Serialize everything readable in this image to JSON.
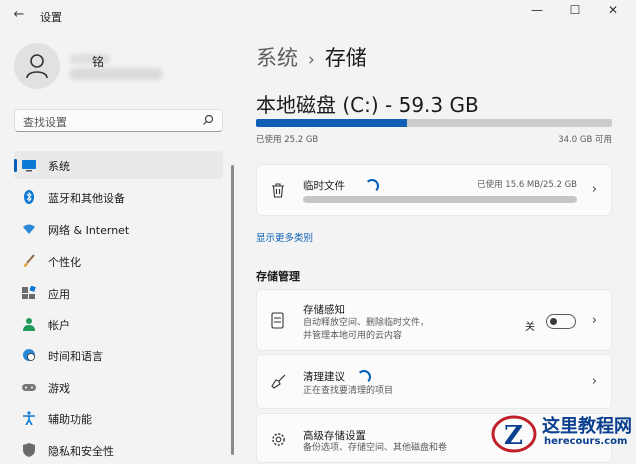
{
  "app": {
    "title": "设置"
  },
  "window": {
    "back_icon": "arrow-left-icon",
    "min_icon": "minimize-icon",
    "max_icon": "maximize-icon",
    "close_icon": "close-icon"
  },
  "user": {
    "name_partial": "铭"
  },
  "search": {
    "placeholder": "查找设置"
  },
  "sidebar": {
    "items": [
      {
        "label": "系统",
        "icon": "monitor-icon",
        "active": true
      },
      {
        "label": "蓝牙和其他设备",
        "icon": "bluetooth-icon"
      },
      {
        "label": "网络 & Internet",
        "icon": "wifi-icon"
      },
      {
        "label": "个性化",
        "icon": "brush-icon"
      },
      {
        "label": "应用",
        "icon": "apps-icon"
      },
      {
        "label": "帐户",
        "icon": "person-icon"
      },
      {
        "label": "时间和语言",
        "icon": "globe-clock-icon"
      },
      {
        "label": "游戏",
        "icon": "gamepad-icon"
      },
      {
        "label": "辅助功能",
        "icon": "accessibility-icon"
      },
      {
        "label": "隐私和安全性",
        "icon": "shield-icon"
      }
    ]
  },
  "breadcrumb": {
    "parent": "系统",
    "sep": "›",
    "current": "存储"
  },
  "disk": {
    "title": "本地磁盘 (C:) - 59.3 GB",
    "used_label": "已使用 25.2 GB",
    "available_label": "34.0 GB 可用",
    "used_fraction": 0.425
  },
  "temp_files": {
    "title": "临时文件",
    "used": "已使用 15.6 MB/25.2 GB"
  },
  "show_more": "显示更多类别",
  "storage_management": {
    "heading": "存储管理",
    "sense": {
      "title": "存储感知",
      "desc1": "自动释放空间、删除临时文件，",
      "desc2": "并管理本地可用的云内容",
      "toggle_label": "关",
      "toggle_on": false
    },
    "cleanup": {
      "title": "清理建议",
      "desc": "正在查找要清理的项目"
    },
    "advanced": {
      "title": "高级存储设置",
      "desc": "备份选项、存储空间、其他磁盘和卷"
    }
  },
  "watermark": {
    "text": "这里教程网",
    "url": "herecours.com"
  },
  "colors": {
    "accent": "#005fb8",
    "bar_fill": "#0f5fb5"
  }
}
